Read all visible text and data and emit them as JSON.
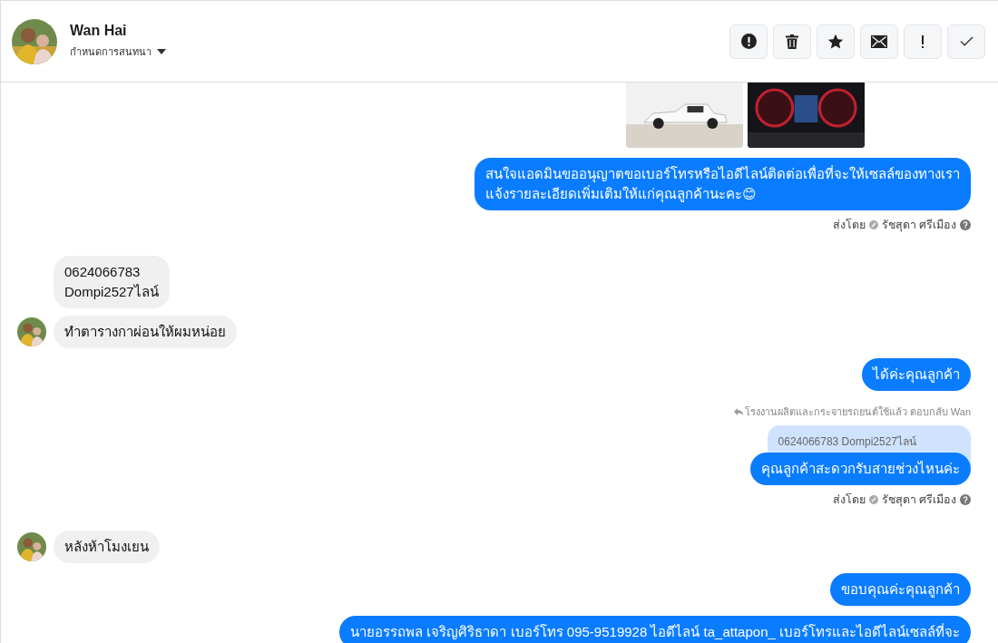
{
  "header": {
    "name": "Wan Hai",
    "subtitle": "กำหนดการสนทนา"
  },
  "messages": [
    {
      "kind": "photos"
    },
    {
      "kind": "out",
      "text": "สนใจแอดมินขออนุญาตขอเบอร์โทรหรือไอดีไลน์ติดต่อเพื่อที่จะให้เซลล์ของทางเรา\nแจ้งรายละเอียดเพิ่มเติมให้แก่คุณลูกค้านะคะ😊"
    },
    {
      "kind": "sent_by",
      "label": "ส่งโดย",
      "agent": "รัชสุดา ศรีเมือง"
    },
    {
      "kind": "in",
      "text": "0624066783\nDompi2527ไลน์",
      "show_avatar": false
    },
    {
      "kind": "in",
      "text": "ทำตารางกาผ่อนให้ผมหน่อย",
      "show_avatar": true
    },
    {
      "kind": "out",
      "text": "ได้ค่ะคุณลูกค้า"
    },
    {
      "kind": "reply_note",
      "text": "โรงงานผลิตและกระจายรถยนต์ใช้แล้ว ตอบกลับ Wan"
    },
    {
      "kind": "quote",
      "text": "0624066783 Dompi2527ไลน์"
    },
    {
      "kind": "out",
      "text": "คุณลูกค้าสะดวกรับสายช่วงไหนค่ะ"
    },
    {
      "kind": "sent_by",
      "label": "ส่งโดย",
      "agent": "รัชสุดา ศรีเมือง"
    },
    {
      "kind": "in",
      "text": "หลังห้าโมงเยน",
      "show_avatar": true
    },
    {
      "kind": "out",
      "text": "ขอบคุณค่ะคุณลูกค้า"
    },
    {
      "kind": "out",
      "text": "นายอรรถพล เจริญศิริธาดา     เบอร์โทร 095-9519928 ไอดีไลน์ ta_attapon_   เบอร์โทรและไอดีไลน์เซลล์ที่จะ"
    }
  ]
}
